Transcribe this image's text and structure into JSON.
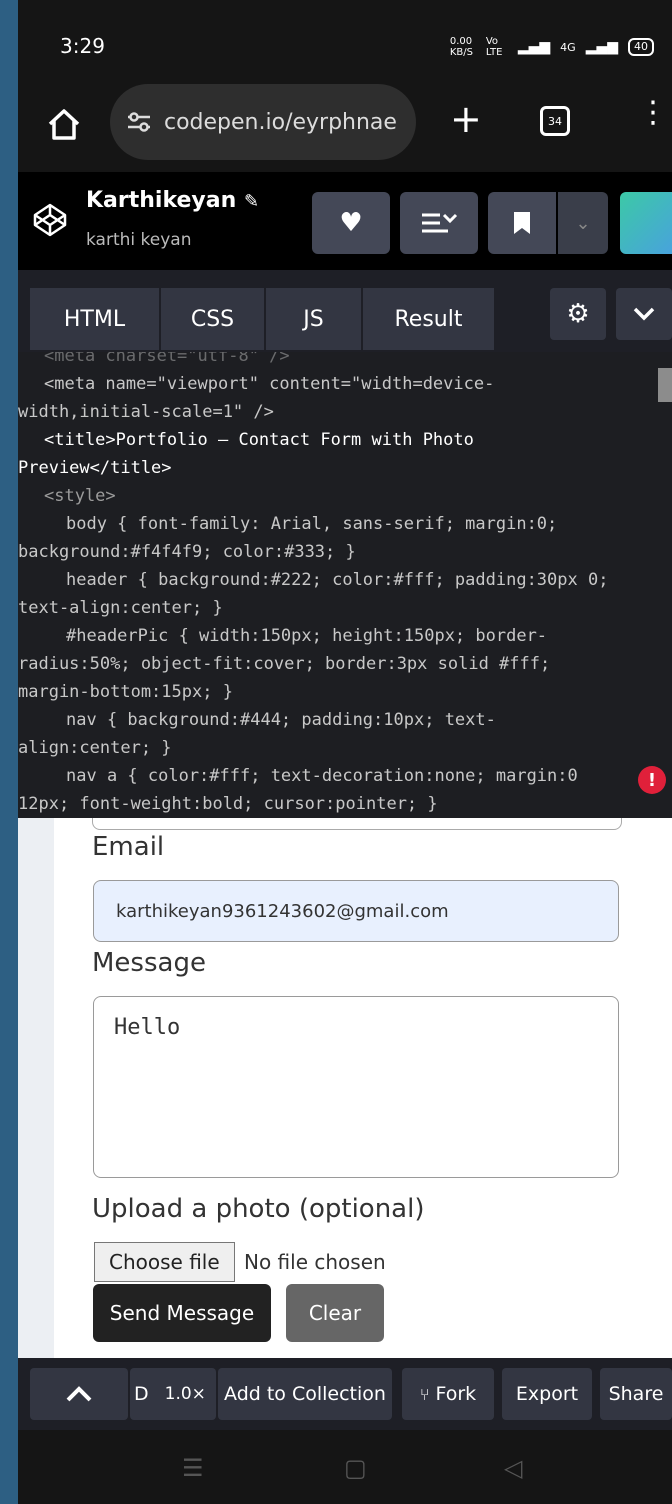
{
  "status": {
    "time": "3:29",
    "speed": "0.00 KB/S",
    "net": "Vo LTE",
    "signal2": "4G",
    "battery": "40"
  },
  "browser": {
    "url": "codepen.io/eyrphnae",
    "tab_count": "34"
  },
  "pen": {
    "owner_name": "Karthikeyan",
    "owner_user": "karthi keyan"
  },
  "tabs": [
    "HTML",
    "CSS",
    "JS",
    "Result"
  ],
  "code_lines": [
    "<meta charset=\"utf-8\" />",
    "<meta name=\"viewport\" content=\"width=device-width,initial-scale=1\" />",
    "<title>Portfolio — Contact Form with Photo Preview</title>",
    "<style>",
    "body { font-family: Arial, sans-serif; margin:0; background:#f4f4f9; color:#333; }",
    "header { background:#222; color:#fff; padding:30px 0; text-align:center; }",
    "#headerPic { width:150px; height:150px; border-radius:50%; object-fit:cover; border:3px solid #fff; margin-bottom:15px; }",
    "nav { background:#444; padding:10px; text-align:center; }",
    "nav a { color:#fff; text-decoration:none; margin:0 12px; font-weight:bold; cursor:pointer; }"
  ],
  "form": {
    "email_label": "Email",
    "email_value": "karthikeyan9361243602@gmail.com",
    "message_label": "Message",
    "message_value": "Hello",
    "upload_label": "Upload a photo (optional)",
    "choose_file": "Choose file",
    "no_file": "No file chosen",
    "send": "Send Message",
    "clear": "Clear"
  },
  "toolbar": {
    "delete_short": "D",
    "zoom": "1.0×",
    "add_collection": "Add to Collection",
    "fork": "Fork",
    "export": "Export",
    "share": "Share"
  }
}
